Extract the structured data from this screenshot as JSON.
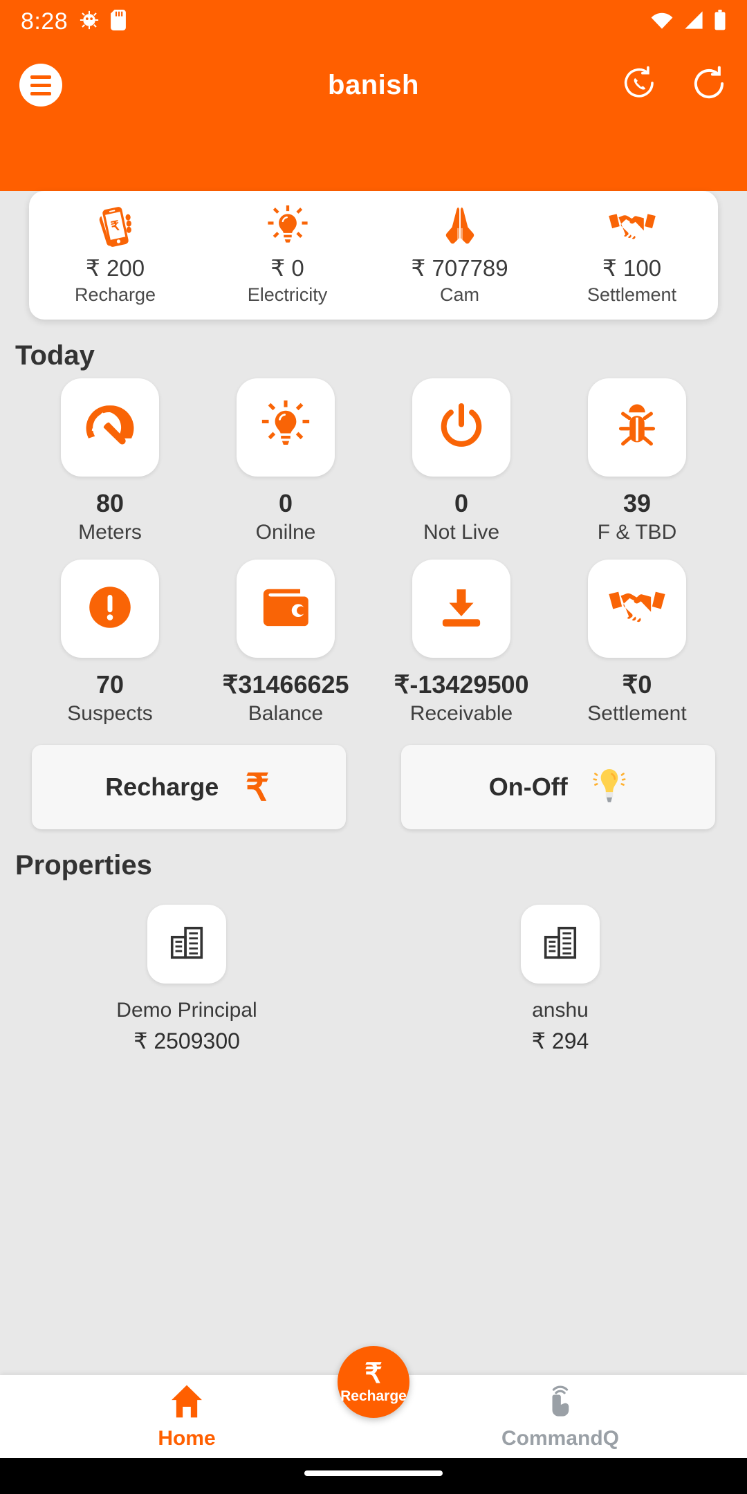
{
  "statusbar": {
    "time": "8:28",
    "icons": [
      "android-bug-icon",
      "sd-card-icon",
      "wifi-icon",
      "cellular-signal-icon",
      "battery-icon"
    ]
  },
  "appbar": {
    "title": "banish",
    "menu_icon": "hamburger-menu-icon",
    "actions": [
      {
        "icon": "phone-refresh-icon"
      },
      {
        "icon": "refresh-icon"
      }
    ]
  },
  "summary_card": {
    "items": [
      {
        "icon": "mobile-recharge-icon",
        "amount": "₹ 200",
        "label": "Recharge"
      },
      {
        "icon": "bulb-icon",
        "amount": "₹ 0",
        "label": "Electricity"
      },
      {
        "icon": "praying-hands-icon",
        "amount": "₹ 707789",
        "label": "Cam"
      },
      {
        "icon": "handshake-icon",
        "amount": "₹ 100",
        "label": "Settlement"
      }
    ]
  },
  "today": {
    "title": "Today",
    "items": [
      {
        "icon": "speedometer-icon",
        "value": "80",
        "label": "Meters"
      },
      {
        "icon": "bulb-icon",
        "value": "0",
        "label": "Onilne"
      },
      {
        "icon": "power-icon",
        "value": "0",
        "label": "Not Live"
      },
      {
        "icon": "bug-icon",
        "value": "39",
        "label": "F & TBD"
      },
      {
        "icon": "alert-circle-icon",
        "value": "70",
        "label": "Suspects"
      },
      {
        "icon": "wallet-icon",
        "value": "₹31466625",
        "label": "Balance"
      },
      {
        "icon": "download-box-icon",
        "value": "₹-13429500",
        "label": "Receivable"
      },
      {
        "icon": "handshake-icon",
        "value": "₹0",
        "label": "Settlement"
      }
    ]
  },
  "actions": {
    "recharge": {
      "label": "Recharge",
      "icon": "rupee-icon"
    },
    "onoff": {
      "label": "On-Off",
      "icon": "yellow-bulb-icon"
    }
  },
  "properties": {
    "title": "Properties",
    "items": [
      {
        "icon": "building-icon",
        "name": "Demo Principal",
        "amount": "₹ 2509300"
      },
      {
        "icon": "building-icon",
        "name": "anshu",
        "amount": "₹ 294"
      }
    ]
  },
  "bottomnav": {
    "home": {
      "label": "Home",
      "icon": "home-icon"
    },
    "fab": {
      "label": "Recharge",
      "symbol": "₹"
    },
    "commandq": {
      "label": "CommandQ",
      "icon": "tap-gesture-icon"
    }
  },
  "colors": {
    "brand_orange": "#ff5f00",
    "page_bg": "#e8e8e8",
    "card_white": "#ffffff",
    "inactive_gray": "#9aa0a6",
    "bulb_yellow": "#ffd24d"
  }
}
